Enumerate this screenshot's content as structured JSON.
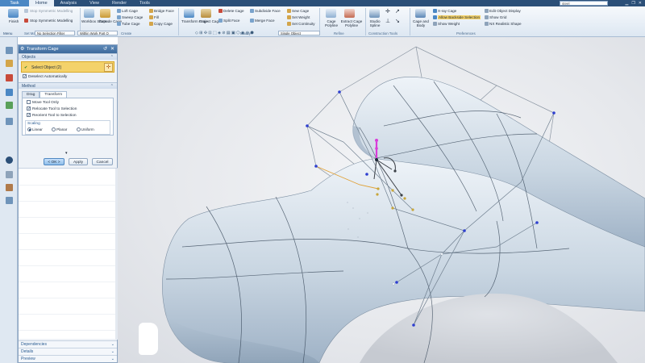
{
  "tabs": [
    "Task",
    "Home",
    "Analysis",
    "View",
    "Render",
    "Tools"
  ],
  "active_tab": "Home",
  "search": {
    "value": "steel"
  },
  "ribbon": {
    "finish": "Finish",
    "stop_symmetric": "Stop Symmetric Modelling",
    "set_master_shape": "Set Master Shape",
    "stop_symmetric2": "Stop Symmetric Modelling",
    "workbox_shape": "Workbox Shape",
    "extrude_cage": "Extrude Cage",
    "create_items": [
      "Loft Cage",
      "Sweep Cage",
      "Tube Cage",
      "Bridge Face",
      "Fill",
      "Copy Cage"
    ],
    "create_label": "Create",
    "transform_cage": "Transform Cage",
    "project_cage": "Project Cage",
    "modify_items": [
      "Delete Cage",
      "Split Face",
      "Subdivide Face",
      "Merge Face",
      "Sew Cage",
      "Set Weight",
      "Set Continuity"
    ],
    "modify_label": "Modify",
    "cage_polyline": "Cage Polyline",
    "extract_cage_polyline": "Extract Cage Polyline",
    "refine_label": "Refine",
    "studio_spline": "Studio Spline",
    "construction_label": "Construction Tools",
    "cage_and_body": "Cage and Body",
    "xray_cage": "X-ray Cage",
    "allow_backside": "Allow Backside Selection",
    "show_weight": "Show Weight",
    "edit_object_display": "Edit Object Display",
    "show_grid": "Show Grid",
    "nx_realistic_shape": "NX Realistic Shape",
    "preferences_label": "Preferences",
    "menu_label": "Menu",
    "selection_filter": "No Selection Filter",
    "within_part": "Within Work Part O",
    "single_object": "Single Object"
  },
  "dialog": {
    "title": "Transform Cage",
    "objects_header": "Objects",
    "select_object": "Select Object (2)",
    "deselect_auto": "Deselect Automatically",
    "method_header": "Method",
    "method_tabs": [
      "Drag",
      "Transform"
    ],
    "move_tool_only": "Move Tool Only",
    "relocate_tool": "Relocate Tool to Selection",
    "reorient_tool": "Reorient Tool to Selection",
    "scaling_label": "Scaling",
    "scaling_options": [
      "Linear",
      "Planar",
      "Uniform"
    ],
    "scaling_selected": "Linear",
    "ok": "< OK >",
    "apply": "Apply",
    "cancel": "Cancel",
    "bottom_sections": [
      "Dependencies",
      "Details",
      "Preview"
    ]
  },
  "colors": {
    "titlebar": "#2b4f78",
    "accent": "#4a87c4",
    "selection_highlight": "#f4d26a",
    "cage_vertex": "#2e3fd0",
    "cage_line": "#6f7f8f",
    "manipulator_magenta": "#d93cd9",
    "surface": "#c9d6e2"
  }
}
